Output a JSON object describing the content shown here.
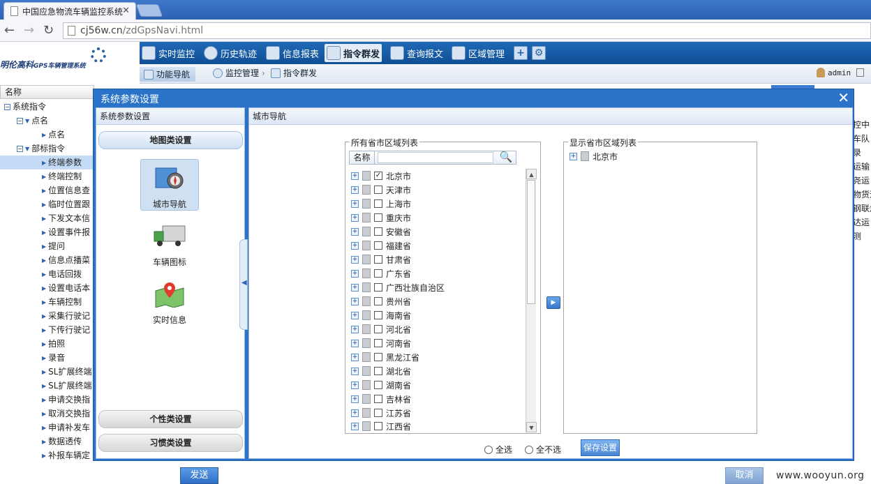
{
  "browser": {
    "tab_title": "中国应急物流车辆监控系统",
    "url": "cj56w.cn/zdGpsNavi.html",
    "url_host": "cj56w.cn",
    "url_path": "/zdGpsNavi.html"
  },
  "app": {
    "logo_text": "明伦高科",
    "logo_sub": "GPS车辆管理系统",
    "menu": [
      {
        "label": "实时监控"
      },
      {
        "label": "历史轨迹"
      },
      {
        "label": "信息报表"
      },
      {
        "label": "指令群发"
      },
      {
        "label": "查询报文"
      },
      {
        "label": "区域管理"
      }
    ],
    "breadcrumb": [
      "功能导航",
      "监控管理",
      "指令群发"
    ],
    "user": "admin"
  },
  "left_panel": {
    "header": "名称",
    "tree": [
      {
        "label": "系统指令",
        "level": 0
      },
      {
        "label": "点名",
        "level": 1
      },
      {
        "label": "点名",
        "level": 2
      },
      {
        "label": "部标指令",
        "level": 1
      },
      {
        "label": "终端参数",
        "level": 2
      },
      {
        "label": "终端控制",
        "level": 2
      },
      {
        "label": "位置信息查",
        "level": 2
      },
      {
        "label": "临时位置跟",
        "level": 2
      },
      {
        "label": "下发文本信",
        "level": 2
      },
      {
        "label": "设置事件报",
        "level": 2
      },
      {
        "label": "提问",
        "level": 2
      },
      {
        "label": "信息点播菜",
        "level": 2
      },
      {
        "label": "电话回拨",
        "level": 2
      },
      {
        "label": "设置电话本",
        "level": 2
      },
      {
        "label": "车辆控制",
        "level": 2
      },
      {
        "label": "采集行驶记",
        "level": 2
      },
      {
        "label": "下传行驶记",
        "level": 2
      },
      {
        "label": "拍照",
        "level": 2
      },
      {
        "label": "录音",
        "level": 2
      },
      {
        "label": "SL扩展终端",
        "level": 2
      },
      {
        "label": "SL扩展终端",
        "level": 2
      },
      {
        "label": "申请交换指",
        "level": 2
      },
      {
        "label": "取消交换指",
        "level": 2
      },
      {
        "label": "申请补发车",
        "level": 2
      },
      {
        "label": "数据透传",
        "level": 2
      },
      {
        "label": "补报车辆定",
        "level": 2
      }
    ]
  },
  "background_right": [
    "控中",
    "车队",
    "录",
    "运输",
    "尧运",
    "物货运",
    "钢联燃",
    "达运",
    "测"
  ],
  "bottom": {
    "send": "发送",
    "cancel": "取消",
    "watermark": "www.wooyun.org"
  },
  "dialog": {
    "title": "系统参数设置",
    "close": "✕",
    "left_header": "系统参数设置",
    "acc_map": "地图类设置",
    "icons": [
      "城市导航",
      "车辆图标",
      "实时信息"
    ],
    "acc_personal": "个性类设置",
    "acc_habit": "习惯类设置",
    "right_header": "城市导航",
    "all_list_legend": "所有省市区域列表",
    "col_name": "名称",
    "provinces": [
      "北京市",
      "天津市",
      "上海市",
      "重庆市",
      "安徽省",
      "福建省",
      "甘肃省",
      "广东省",
      "广西壮族自治区",
      "贵州省",
      "海南省",
      "河北省",
      "河南省",
      "黑龙江省",
      "湖北省",
      "湖南省",
      "吉林省",
      "江苏省",
      "江西省"
    ],
    "checked_index": 0,
    "shown_list_legend": "显示省市区域列表",
    "shown": [
      "北京市"
    ],
    "select_all": "全选",
    "select_none": "全不选",
    "save": "保存设置"
  }
}
